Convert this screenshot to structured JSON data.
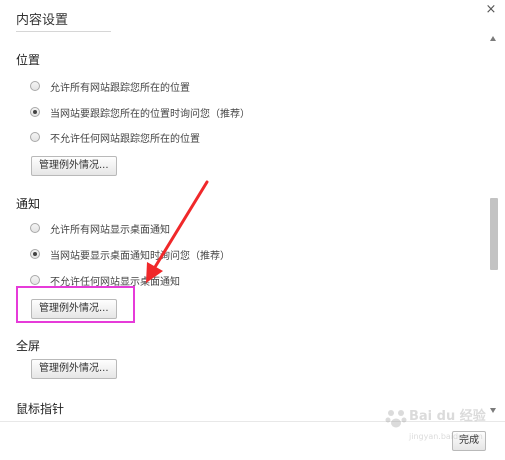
{
  "dialog": {
    "title": "内容设置",
    "close_glyph": "×",
    "done_label": "完成"
  },
  "location": {
    "heading": "位置",
    "options": [
      {
        "label": "允许所有网站跟踪您所在的位置",
        "checked": false
      },
      {
        "label": "当网站要跟踪您所在的位置时询问您（推荐）",
        "checked": true
      },
      {
        "label": "不允许任何网站跟踪您所在的位置",
        "checked": false
      }
    ],
    "manage_label": "管理例外情况..."
  },
  "notifications": {
    "heading": "通知",
    "options": [
      {
        "label": "允许所有网站显示桌面通知",
        "checked": false
      },
      {
        "label": "当网站要显示桌面通知时询问您（推荐）",
        "checked": true
      },
      {
        "label": "不允许任何网站显示桌面通知",
        "checked": false
      }
    ],
    "manage_label": "管理例外情况..."
  },
  "fullscreen": {
    "heading": "全屏",
    "manage_label": "管理例外情况..."
  },
  "mouse_pointer": {
    "heading": "鼠标指针"
  },
  "watermark": {
    "text": "Bai du 经验",
    "sub": "jingyan.baidu.com"
  },
  "colors": {
    "highlight": "#e63bd9",
    "arrow": "#f0282a"
  }
}
